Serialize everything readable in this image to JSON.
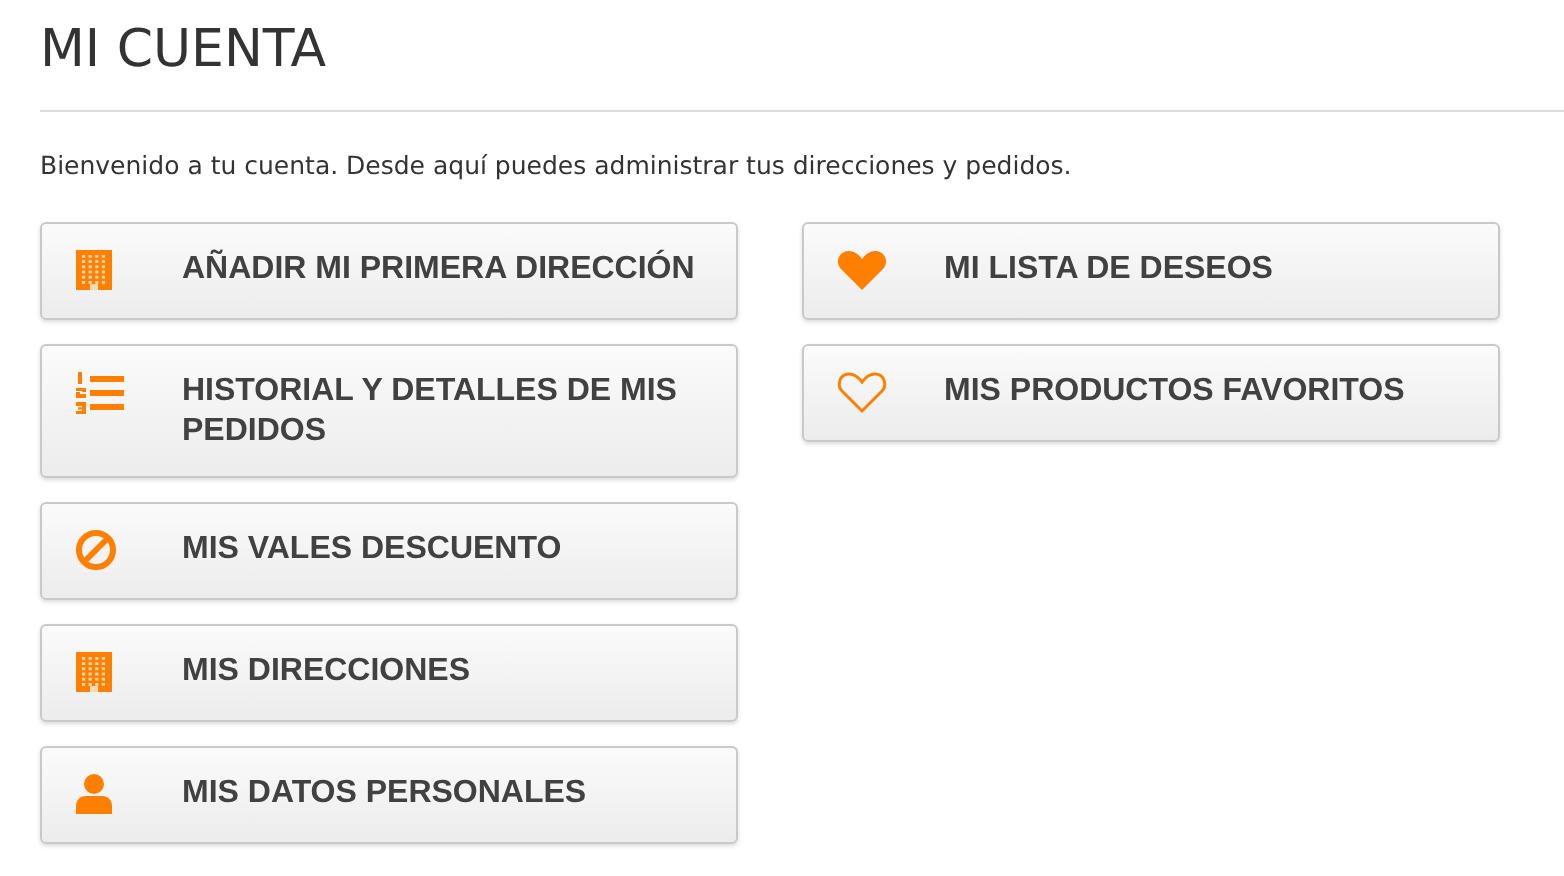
{
  "title": "MI CUENTA",
  "intro": "Bienvenido a tu cuenta. Desde aquí puedes administrar tus direcciones y pedidos.",
  "columns": [
    [
      {
        "kind": "building",
        "label": "AÑADIR MI PRIMERA DIRECCIÓN"
      },
      {
        "kind": "list",
        "label": "HISTORIAL Y DETALLES DE MIS PEDIDOS"
      },
      {
        "kind": "ban",
        "label": "MIS VALES DESCUENTO"
      },
      {
        "kind": "building",
        "label": "MIS DIRECCIONES"
      },
      {
        "kind": "user",
        "label": "MIS DATOS PERSONALES"
      }
    ],
    [
      {
        "kind": "heart",
        "label": "MI LISTA DE DESEOS"
      },
      {
        "kind": "heart-outline",
        "label": "MIS PRODUCTOS FAVORITOS"
      }
    ]
  ]
}
